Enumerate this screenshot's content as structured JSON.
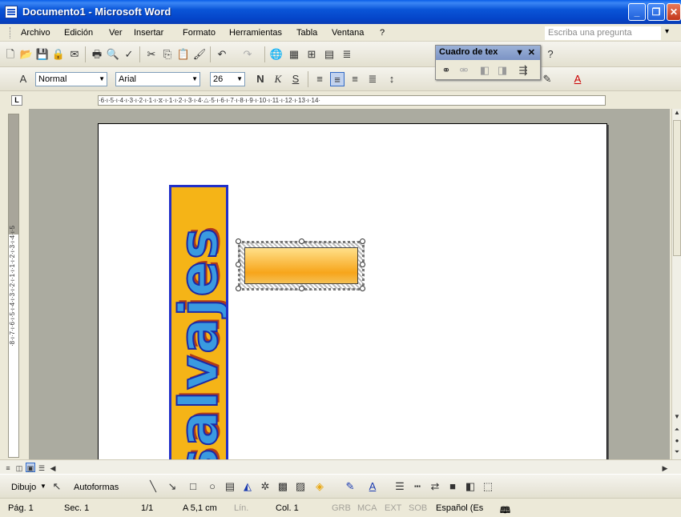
{
  "window": {
    "title": "Documento1 - Microsoft Word",
    "minimize": "_",
    "maximize": "❐",
    "close": "✕"
  },
  "menu": {
    "items": [
      "Archivo",
      "Edición",
      "Ver",
      "Insertar",
      "Formato",
      "Herramientas",
      "Tabla",
      "Ventana",
      "?"
    ],
    "ask_placeholder": "Escriba una pregunta",
    "ask_arrow": "▾"
  },
  "formatting": {
    "style": "Normal",
    "font": "Arial",
    "size": "26"
  },
  "floating_toolbar": {
    "title": "Cuadro de tex",
    "menu_arrow": "▼",
    "close": "✕"
  },
  "ruler": {
    "horizontal": "·6·ı·5·ı·4·ı·3·ı·2·ı·1·ı·⧖·ı·1·ı·2·ı·3·ı·4·△·5·ı·6·ı·7·ı·8·ı·9·ı·10·ı·11·ı·12·ı·13·ı·14·",
    "vertical": "·8·ı·7·ı·6·ı·5·ı·4·ı·3·ı·2·ı·1·ı·1·ı·2·ı·3·ı·4·ı·5",
    "tab_selector": "L"
  },
  "document": {
    "wordart_text": "salvajes"
  },
  "drawing_toolbar": {
    "draw_label": "Dibujo",
    "autoshapes_label": "Autoformas"
  },
  "status": {
    "page": "Pág. 1",
    "section": "Sec. 1",
    "page_count": "1/1",
    "at": "A 5,1 cm",
    "line": "Lín.",
    "column": "Col. 1",
    "grb": "GRB",
    "mca": "MCA",
    "ext": "EXT",
    "sob": "SOB",
    "language": "Español (Es"
  },
  "colors": {
    "wordart_fill": "#3a9ae0",
    "wordart_box": "#f5b417",
    "textbox_gradient": "#f7a51a"
  }
}
